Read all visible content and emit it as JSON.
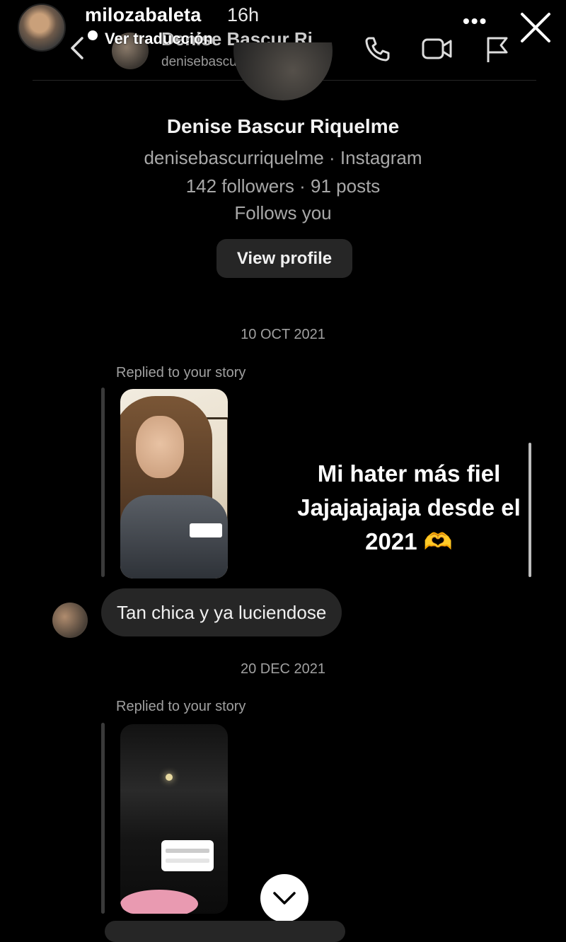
{
  "story": {
    "username": "milozabaleta",
    "time": "16h",
    "more_label": "•••",
    "translate_label": "Ver traducción"
  },
  "dm_header": {
    "name": "Denise Bascur Ri...",
    "handle": "denisebascurriquelme"
  },
  "profile": {
    "name": "Denise Bascur Riquelme",
    "subtitle": "denisebascurriquelme · Instagram",
    "stats": "142 followers · 91 posts",
    "follows": "Follows you",
    "view_button": "View profile"
  },
  "conversation": {
    "date1": "10 OCT 2021",
    "replied1": "Replied to your story",
    "message1": "Tan chica y ya luciendose",
    "date2": "20 DEC 2021",
    "replied2": "Replied to your story"
  },
  "overlay": {
    "line1": "Mi hater más fiel",
    "line2": "Jajajajajaja desde el",
    "line3": "2021 🫶"
  },
  "icons": [
    "close-icon",
    "back-icon",
    "phone-icon",
    "video-icon",
    "flag-icon",
    "chevron-down-icon"
  ],
  "colors": {
    "background": "#000000",
    "bubble": "#262626",
    "muted_text": "#a8a8a8"
  }
}
